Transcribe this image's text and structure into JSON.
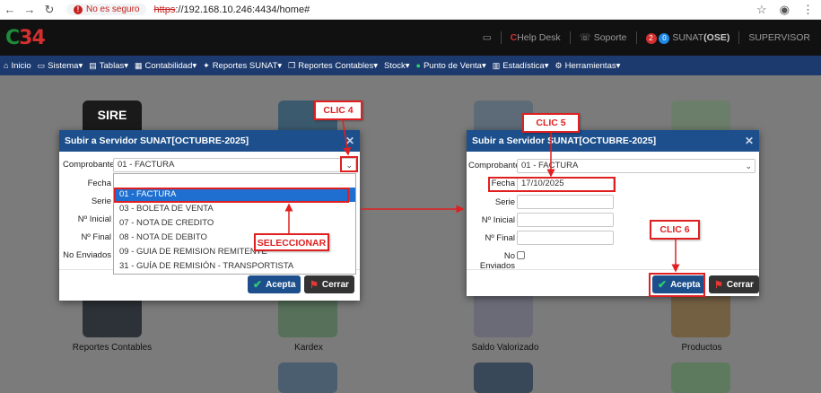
{
  "browser": {
    "security_label": "No es seguro",
    "url_proto": "https",
    "url_rest": "://192.168.10.246:4434/home#"
  },
  "header": {
    "help_label": "Help Desk",
    "support_label": "Soporte",
    "badge_red": "2",
    "badge_blue": "0",
    "sunat_label": "SUNAT",
    "ose_label": "(OSE)",
    "user_label": "SUPERVISOR"
  },
  "menu": {
    "items": [
      "Inicio",
      "Sistema",
      "Tablas",
      "Contabilidad",
      "Reportes SUNAT",
      "Reportes Contables",
      "Stock",
      "Punto de Venta",
      "Estadística",
      "Herramientas"
    ]
  },
  "dashboard": {
    "tile_labels": [
      "Reportes Contables",
      "Kardex",
      "Saldo Valorizado",
      "Productos"
    ],
    "partial_label": "SIRE"
  },
  "dialog_left": {
    "title": "Subir a Servidor SUNAT[OCTUBRE-2025]",
    "labels": {
      "comprobante": "Comprobante",
      "fecha": "Fecha",
      "serie": "Serie",
      "inicial": "Nº Inicial",
      "final": "Nº Final",
      "enviados": "No Enviados"
    },
    "comprobante_value": "01 - FACTURA",
    "dropdown_options": [
      "01 - FACTURA",
      "03 - BOLETA DE VENTA",
      "07 - NOTA DE CREDITO",
      "08 - NOTA DE DEBITO",
      "09 - GUIA DE REMISION REMITENTE",
      "31 - GUÍA DE REMISIÓN - TRANSPORTISTA"
    ],
    "accept_label": "Acepta",
    "close_label": "Cerrar"
  },
  "dialog_right": {
    "title": "Subir a Servidor SUNAT[OCTUBRE-2025]",
    "labels": {
      "comprobante": "Comprobante",
      "fecha": "Fecha",
      "serie": "Serie",
      "inicial": "Nº Inicial",
      "final": "Nº Final",
      "enviados": "No Enviados"
    },
    "comprobante_value": "01 - FACTURA",
    "fecha_value": "17/10/2025",
    "accept_label": "Acepta",
    "close_label": "Cerrar"
  },
  "annotations": {
    "clic4": "CLIC 4",
    "clic5": "CLIC 5",
    "clic6": "CLIC 6",
    "seleccionar": "SELECCIONAR",
    "color": "#e02020"
  }
}
